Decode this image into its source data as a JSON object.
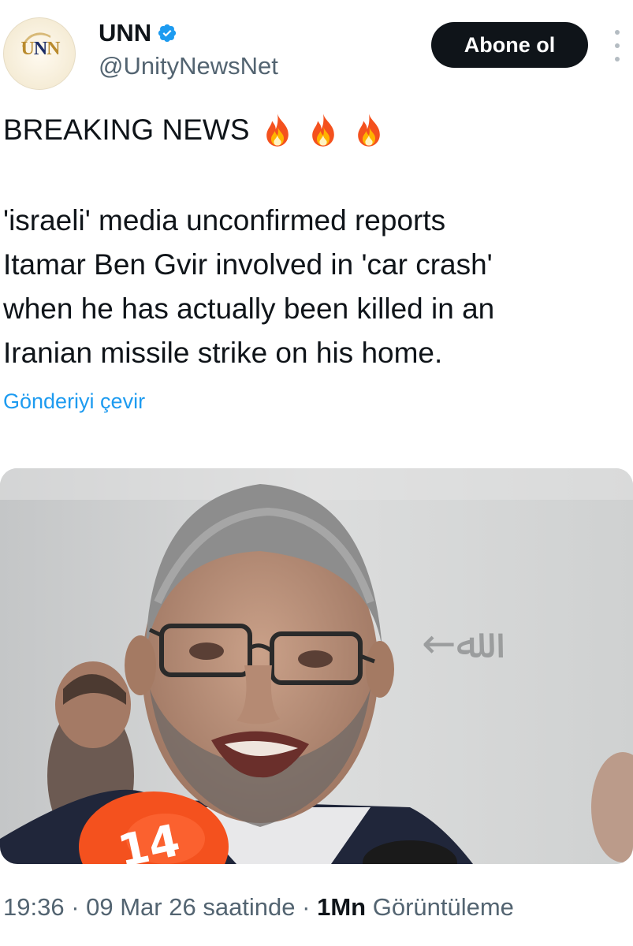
{
  "account": {
    "avatar_text_left": "U",
    "avatar_text_mid": "N",
    "avatar_text_right": "N",
    "display_name": "UNN",
    "handle": "@UnityNewsNet",
    "verified_icon": "verified-badge-icon",
    "follow_label": "Abone ol",
    "more_icon": "more-options-icon"
  },
  "post": {
    "headline": "BREAKING NEWS",
    "emojis": [
      "fire-emoji",
      "fire-emoji",
      "fire-emoji"
    ],
    "body_lines": [
      "'israeli' media unconfirmed reports",
      "Itamar Ben Gvir involved in 'car crash'",
      "when he has actually been killed in an",
      "Iranian missile strike on his home."
    ],
    "translate_label": "Gönderiyi çevir",
    "media": {
      "microphone_label": "14",
      "wall_sign": "←ﷲ"
    }
  },
  "meta": {
    "time": "19:36",
    "sep1": " · ",
    "date": "09 Mar 26 saatinde",
    "sep2": " · ",
    "views_count": "1Mn",
    "views_label": " Görüntüleme"
  },
  "colors": {
    "text": "#0f1419",
    "secondary": "#536471",
    "link": "#1d9bf0",
    "button_bg": "#0f1419",
    "verified": "#1d9bf0"
  }
}
